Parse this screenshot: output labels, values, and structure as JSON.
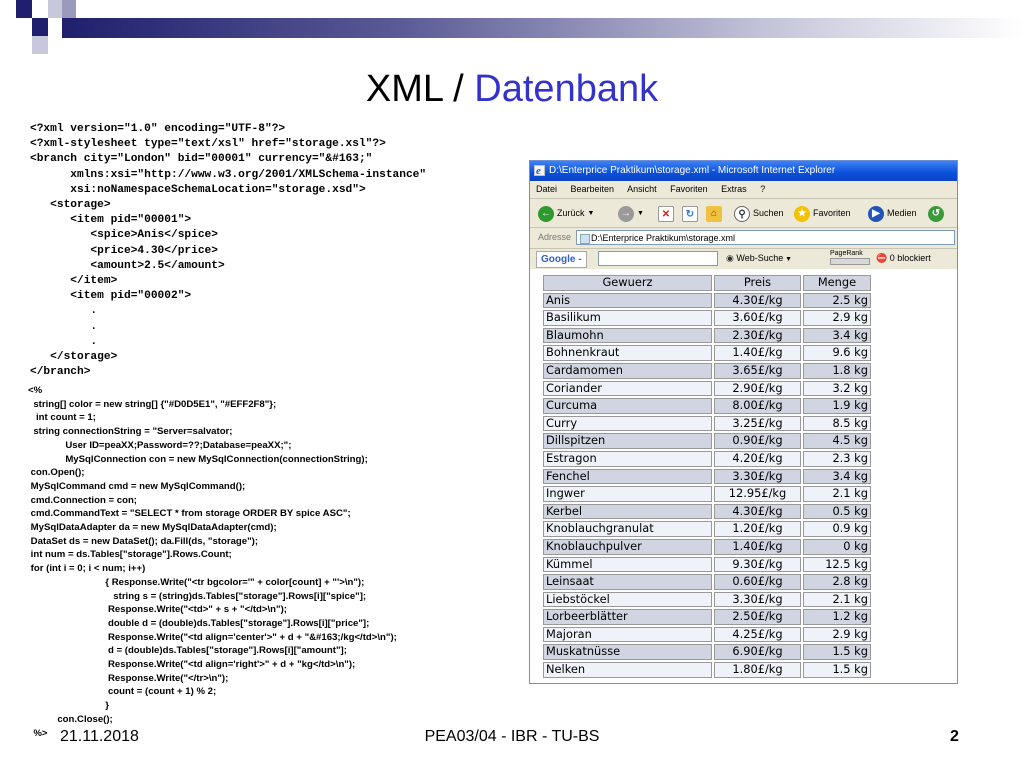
{
  "slide": {
    "title_main": "XML / ",
    "title_accent": "Datenbank",
    "footer": {
      "date": "21.11.2018",
      "center": "PEA03/04 - IBR - TU-BS",
      "page": "2"
    }
  },
  "xml_text": "<?xml version=\"1.0\" encoding=\"UTF-8\"?>\n<?xml-stylesheet type=\"text/xsl\" href=\"storage.xsl\"?>\n<branch city=\"London\" bid=\"00001\" currency=\"&#163;\"\n      xmlns:xsi=\"http://www.w3.org/2001/XMLSchema-instance\"\n      xsi:noNamespaceSchemaLocation=\"storage.xsd\">\n   <storage>\n      <item pid=\"00001\">\n         <spice>Anis</spice>\n         <price>4.30</price>\n         <amount>2.5</amount>\n      </item>\n      <item pid=\"00002\">\n         .\n         .\n         .\n   </storage>\n</branch>",
  "code_text": "<%\n  string[] color = new string[] {\"#D0D5E1\", \"#EFF2F8\"};\n   int count = 1;\n  string connectionString = \"Server=salvator;\n              User ID=peaXX;Password=??;Database=peaXX;\";\n              MySqlConnection con = new MySqlConnection(connectionString);\n con.Open();\n MySqlCommand cmd = new MySqlCommand();\n cmd.Connection = con;\n cmd.CommandText = \"SELECT * from storage ORDER BY spice ASC\";\n MySqlDataAdapter da = new MySqlDataAdapter(cmd);\n DataSet ds = new DataSet(); da.Fill(ds, \"storage\");\n int num = ds.Tables[\"storage\"].Rows.Count;\n for (int i = 0; i < num; i++)\n                             { Response.Write(\"<tr bgcolor='\" + color[count] + \"'>\\n\");\n                                string s = (string)ds.Tables[\"storage\"].Rows[i][\"spice\"];\n                              Response.Write(\"<td>\" + s + \"</td>\\n\");\n                              double d = (double)ds.Tables[\"storage\"].Rows[i][\"price\"];\n                              Response.Write(\"<td align='center'>\" + d + \"&#163;/kg</td>\\n\");\n                              d = (double)ds.Tables[\"storage\"].Rows[i][\"amount\"];\n                              Response.Write(\"<td align='right'>\" + d + \"kg</td>\\n\");\n                              Response.Write(\"</tr>\\n\");\n                              count = (count + 1) % 2;\n                             }\n           con.Close();\n  %>",
  "browser": {
    "window_title": "D:\\Enterprice Praktikum\\storage.xml - Microsoft Internet Explorer",
    "menu": [
      "Datei",
      "Bearbeiten",
      "Ansicht",
      "Favoriten",
      "Extras",
      "?"
    ],
    "toolbar": {
      "back": "Zurück",
      "search": "Suchen",
      "favorites": "Favoriten",
      "media": "Medien"
    },
    "address_label": "Adresse",
    "address_value": "D:\\Enterprice Praktikum\\storage.xml",
    "google": {
      "brand": "Google -",
      "web_search": "Web-Suche",
      "pagerank": "PageRank",
      "blocked": "0 blockiert"
    },
    "table": {
      "headers": [
        "Gewuerz",
        "Preis",
        "Menge"
      ],
      "row_colors": [
        "#D0D5E1",
        "#EFF2F8"
      ],
      "rows": [
        [
          "Anis",
          "4.30£/kg",
          "2.5 kg"
        ],
        [
          "Basilikum",
          "3.60£/kg",
          "2.9 kg"
        ],
        [
          "Blaumohn",
          "2.30£/kg",
          "3.4 kg"
        ],
        [
          "Bohnenkraut",
          "1.40£/kg",
          "9.6 kg"
        ],
        [
          "Cardamomen",
          "3.65£/kg",
          "1.8 kg"
        ],
        [
          "Coriander",
          "2.90£/kg",
          "3.2 kg"
        ],
        [
          "Curcuma",
          "8.00£/kg",
          "1.9 kg"
        ],
        [
          "Curry",
          "3.25£/kg",
          "8.5 kg"
        ],
        [
          "Dillspitzen",
          "0.90£/kg",
          "4.5 kg"
        ],
        [
          "Estragon",
          "4.20£/kg",
          "2.3 kg"
        ],
        [
          "Fenchel",
          "3.30£/kg",
          "3.4 kg"
        ],
        [
          "Ingwer",
          "12.95£/kg",
          "2.1 kg"
        ],
        [
          "Kerbel",
          "4.30£/kg",
          "0.5 kg"
        ],
        [
          "Knoblauchgranulat",
          "1.20£/kg",
          "0.9 kg"
        ],
        [
          "Knoblauchpulver",
          "1.40£/kg",
          "0 kg"
        ],
        [
          "Kümmel",
          "9.30£/kg",
          "12.5 kg"
        ],
        [
          "Leinsaat",
          "0.60£/kg",
          "2.8 kg"
        ],
        [
          "Liebstöckel",
          "3.30£/kg",
          "2.1 kg"
        ],
        [
          "Lorbeerblätter",
          "2.50£/kg",
          "1.2 kg"
        ],
        [
          "Majoran",
          "4.25£/kg",
          "2.9 kg"
        ],
        [
          "Muskatnüsse",
          "6.90£/kg",
          "1.5 kg"
        ],
        [
          "Nelken",
          "1.80£/kg",
          "1.5 kg"
        ]
      ]
    }
  }
}
